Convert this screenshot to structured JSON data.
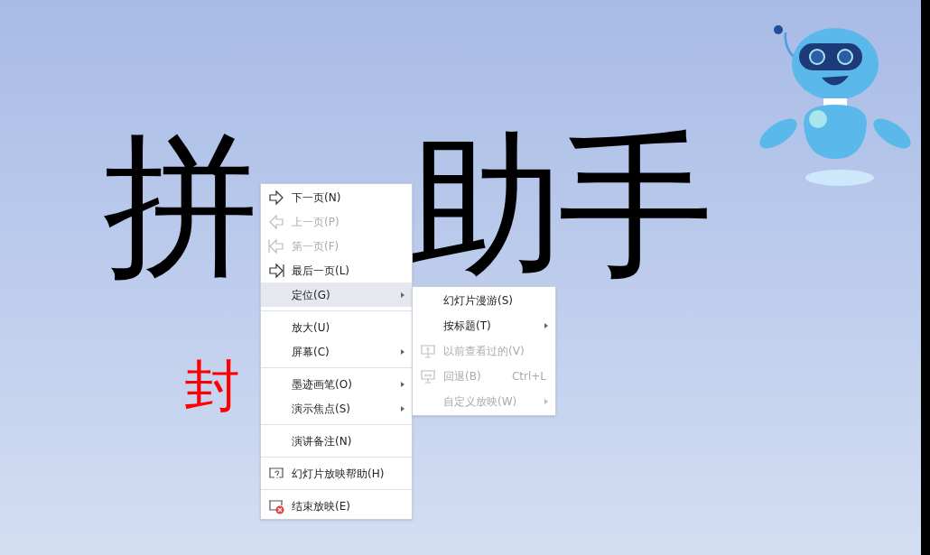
{
  "slide": {
    "title_parts": [
      "拼",
      "助手"
    ],
    "subtitle": "封"
  },
  "context_menu": {
    "items": [
      {
        "kind": "item",
        "label": "下一页(N)",
        "disabled": false,
        "selected": false,
        "submenu": false
      },
      {
        "kind": "item",
        "label": "上一页(P)",
        "disabled": true,
        "selected": false,
        "submenu": false
      },
      {
        "kind": "item",
        "label": "第一页(F)",
        "disabled": true,
        "selected": false,
        "submenu": false
      },
      {
        "kind": "item",
        "label": "最后一页(L)",
        "disabled": false,
        "selected": false,
        "submenu": false
      },
      {
        "kind": "item",
        "label": "定位(G)",
        "disabled": false,
        "selected": true,
        "submenu": true
      },
      {
        "kind": "separator"
      },
      {
        "kind": "item",
        "label": "放大(U)",
        "disabled": false,
        "selected": false,
        "submenu": false
      },
      {
        "kind": "item",
        "label": "屏幕(C)",
        "disabled": false,
        "selected": false,
        "submenu": true
      },
      {
        "kind": "separator"
      },
      {
        "kind": "item",
        "label": "墨迹画笔(O)",
        "disabled": false,
        "selected": false,
        "submenu": true
      },
      {
        "kind": "item",
        "label": "演示焦点(S)",
        "disabled": false,
        "selected": false,
        "submenu": true
      },
      {
        "kind": "separator"
      },
      {
        "kind": "item",
        "label": "演讲备注(N)",
        "disabled": false,
        "selected": false,
        "submenu": false
      },
      {
        "kind": "separator"
      },
      {
        "kind": "item",
        "label": "幻灯片放映帮助(H)",
        "disabled": false,
        "selected": false,
        "submenu": false
      },
      {
        "kind": "separator"
      },
      {
        "kind": "item",
        "label": "结束放映(E)",
        "disabled": false,
        "selected": false,
        "submenu": false
      }
    ]
  },
  "submenu": {
    "items": [
      {
        "label": "幻灯片漫游(S)",
        "disabled": false,
        "submenu": false
      },
      {
        "label": "按标题(T)",
        "disabled": false,
        "submenu": true
      },
      {
        "label": "以前查看过的(V)",
        "disabled": true,
        "submenu": false
      },
      {
        "label": "回退(B)",
        "shortcut": "Ctrl+L",
        "disabled": true,
        "submenu": false
      },
      {
        "label": "自定义放映(W)",
        "disabled": true,
        "submenu": true
      }
    ]
  }
}
